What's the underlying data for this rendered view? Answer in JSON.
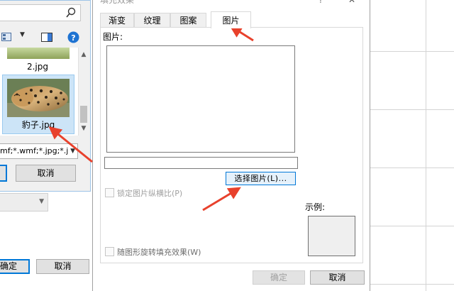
{
  "file_dialog": {
    "search_placeholder": "",
    "files": [
      {
        "name": "2.jpg"
      },
      {
        "name": "豹子.jpg"
      }
    ],
    "file_type_filter": "mf;*.wmf;*.jpg;*.j",
    "ok_label": "",
    "cancel_label": "取消"
  },
  "background_dialog": {
    "ok_label": "确定",
    "cancel_label": "取消"
  },
  "fill_effects": {
    "title": "填充效果",
    "help": "?",
    "close": "✕",
    "tabs": [
      {
        "label": "渐变"
      },
      {
        "label": "纹理"
      },
      {
        "label": "图案"
      },
      {
        "label": "图片",
        "active": true
      }
    ],
    "picture_label": "图片:",
    "path_value": "",
    "select_picture_label": "选择图片(L)...",
    "lock_aspect_label": "锁定图片纵横比(P)",
    "sample_label": "示例:",
    "rotate_with_shape_label": "随图形旋转填充效果(W)",
    "ok_label": "确定",
    "cancel_label": "取消"
  },
  "colors": {
    "accent": "#0078d7",
    "annotation_arrow": "#e8412c"
  }
}
